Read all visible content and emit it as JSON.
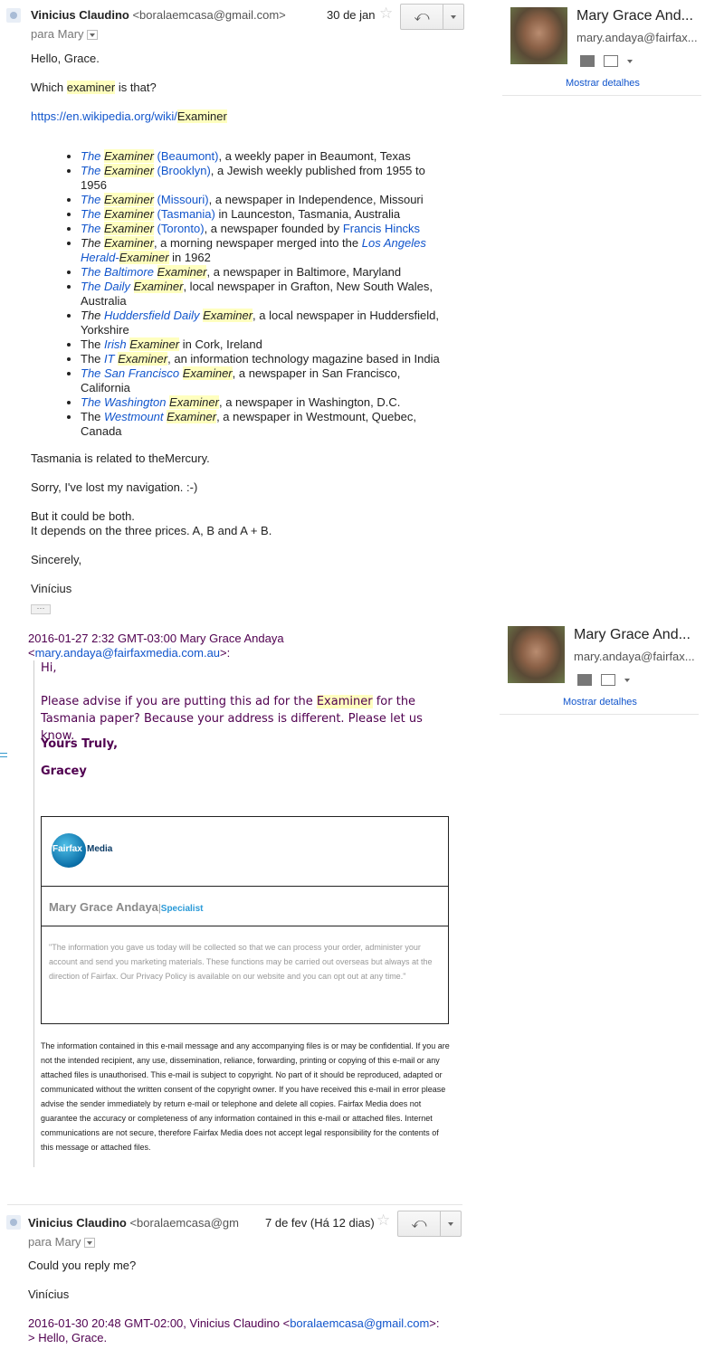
{
  "msg1": {
    "sender_name": "Vinicius Claudino",
    "sender_email": "<boralaemcasa@gmail.com>",
    "to": "para Mary",
    "date": "30 de jan",
    "greeting": "Hello, Grace.",
    "q_pre": "Which ",
    "q_hl": "examiner",
    "q_post": " is that?",
    "link_pre": "https://en.wikipedia.org/wiki/",
    "link_hl": "Examiner",
    "list": [
      {
        "pre_it": "The ",
        "hl_it": "Examiner",
        "link_tail": " (Beaumont)",
        "text": ", a weekly paper in Beaumont, Texas"
      },
      {
        "pre_it": "The ",
        "hl_it": "Examiner",
        "link_tail": " (Brooklyn)",
        "text": ", a Jewish weekly published from 1955 to 1956"
      },
      {
        "pre_it": "The ",
        "hl_it": "Examiner",
        "link_tail": " (Missouri)",
        "text": ", a newspaper in Independence, Missouri"
      },
      {
        "pre_it": "The ",
        "hl_it": "Examiner",
        "link_tail": " (Tasmania)",
        "text": " in Launceston, Tasmania, Australia"
      },
      {
        "pre_it": "The ",
        "hl_it": "Examiner",
        "link_tail": " (Toronto)",
        "text": ", a newspaper founded by ",
        "link2": "Francis Hincks"
      }
    ],
    "li6": {
      "a": "The ",
      "b": "Examiner",
      "c": ", a morning newspaper merged into the ",
      "d": "Los Angeles Herald-",
      "e": "Examiner",
      "f": " in 1962"
    },
    "li7": {
      "a": "The Baltimore ",
      "b": "Examiner",
      "c": ", a newspaper in Baltimore, Maryland"
    },
    "li8": {
      "a": "The Daily ",
      "b": "Examiner",
      "c": ", local newspaper in Grafton, New South Wales, Australia"
    },
    "li9": {
      "a": "The ",
      "b": "Huddersfield Daily ",
      "c": "Examiner",
      "d": ", a local newspaper in Huddersfield, Yorkshire"
    },
    "li10": {
      "a": "The ",
      "b": "Irish ",
      "c": "Examiner",
      "d": " in Cork, Ireland"
    },
    "li11": {
      "a": "The ",
      "b": "IT ",
      "c": "Examiner",
      "d": ", an information technology magazine based in India"
    },
    "li12": {
      "a": "The San Francisco ",
      "b": "Examiner",
      "c": ", a newspaper in San Francisco, California"
    },
    "li13": {
      "a": "The Washington ",
      "b": "Examiner",
      "c": ", a newspaper in Washington, D.C."
    },
    "li14": {
      "a": "The ",
      "b": "Westmount ",
      "c": "Examiner",
      "d": ", a newspaper in Westmount, Quebec, Canada"
    },
    "p1": "Tasmania is related to theMercury.",
    "p2": "Sorry, I've lost my navigation. :-)",
    "p3a": "But it could be both.",
    "p3b": "It depends on the three prices. A, B and A + B.",
    "p4": "Sincerely,",
    "p5": "Vinícius",
    "ellipsis": "···"
  },
  "card": {
    "name": "Mary Grace And...",
    "email": "mary.andaya@fairfax...",
    "details": "Mostrar detalhes"
  },
  "quote": {
    "header1": "2016-01-27 2:32 GMT-03:00 Mary Grace Andaya",
    "header2_pre": "<",
    "header2_link": "mary.andaya@fairfaxmedia.com.au",
    "header2_post": ">:",
    "hi": "Hi,",
    "body_pre": "Please advise if you are putting this ad for the ",
    "body_hl": "Examiner",
    "body_post": " for the Tasmania paper? Because your address is different. Please let us know.",
    "yours": "Yours Truly,",
    "gracey": "Gracey",
    "logo_a": "Fairfax",
    "logo_b": "Media",
    "sig_name": "Mary Grace Andaya",
    "sig_sep": "|",
    "sig_title": "Specialist",
    "privacy": "\"The information you gave us today will be collected so that we can process your order, administer your account and send you marketing materials. These functions may be carried out overseas but always at the direction of Fairfax. Our Privacy Policy is available on our website and you can opt out at any time.\"",
    "disclaimer": "The information contained in this e-mail message and any accompanying files is or may be confidential. If you are not the intended recipient, any use, dissemination, reliance, forwarding, printing or copying of this e-mail or any attached files is unauthorised. This e-mail is subject to copyright. No part of it should be reproduced, adapted or communicated without the written consent of the copyright owner. If you have received this e-mail in error please advise the sender immediately by return e-mail or telephone and delete all copies. Fairfax Media does not guarantee the accuracy or completeness of any information contained in this e-mail or attached files. Internet communications are not secure, therefore Fairfax Media does not accept legal responsibility for the contents of this message or attached files."
  },
  "msg2": {
    "sender_name": "Vinicius Claudino",
    "sender_email": "<boralaemcasa@gm",
    "to": "para Mary",
    "date": "7 de fev (Há 12 dias)",
    "body": "Could you reply me?",
    "sign": "Vinícius",
    "quote_hdr_pre": "2016-01-30 20:48 GMT-02:00, Vinicius Claudino <",
    "quote_hdr_link": "boralaemcasa@gmail.com",
    "quote_hdr_post": ">:",
    "quote_line": "> Hello, Grace."
  }
}
